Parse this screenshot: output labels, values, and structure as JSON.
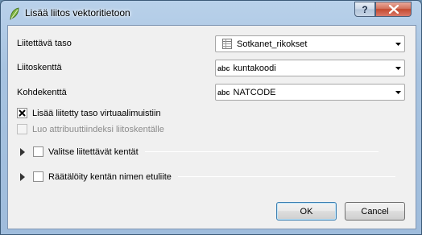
{
  "window": {
    "title": "Lisää liitos vektoritietoon",
    "help_label": "?"
  },
  "form": {
    "join_layer": {
      "label": "Liitettävä taso",
      "value": "Sotkanet_rikokset"
    },
    "join_field": {
      "label": "Liitoskenttä",
      "value": "kuntakoodi",
      "type_badge": "abc"
    },
    "target_field": {
      "label": "Kohdekenttä",
      "value": "NATCODE",
      "type_badge": "abc"
    }
  },
  "options": {
    "cache_virtual": {
      "label": "Lisää liitetty taso virtuaalimuistiin",
      "checked": true
    },
    "create_index": {
      "label": "Luo attribuuttiindeksi liitoskentälle",
      "checked": false,
      "disabled": true
    }
  },
  "groups": {
    "select_fields": {
      "label": "Valitse liitettävät kentät",
      "checked": false
    },
    "custom_prefix": {
      "label": "Räätälöity kentän nimen etuliite",
      "checked": false
    }
  },
  "buttons": {
    "ok": "OK",
    "cancel": "Cancel"
  },
  "colors": {
    "frame": "#a7c3e0",
    "client_bg": "#f0f0f0",
    "close_button": "#c44a2f"
  }
}
